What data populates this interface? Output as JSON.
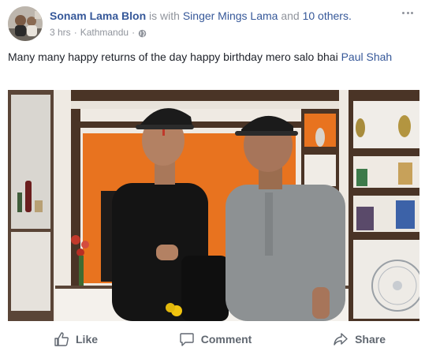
{
  "post": {
    "author": "Sonam Lama Blon",
    "with_text": "is with",
    "tagged_person": "Singer Mings Lama",
    "and_text": "and",
    "others_text": "10 others.",
    "time": "3 hrs",
    "separator": "·",
    "location": "Kathmandu",
    "privacy_icon": "globe-icon",
    "message": "Many many happy returns of the day happy birthday mero salo bhai",
    "message_tag": "Paul Shah"
  },
  "actions": {
    "like_label": "Like",
    "comment_label": "Comment",
    "share_label": "Share"
  },
  "colors": {
    "link": "#365899",
    "meta": "#90949c",
    "action_text": "#606770"
  }
}
